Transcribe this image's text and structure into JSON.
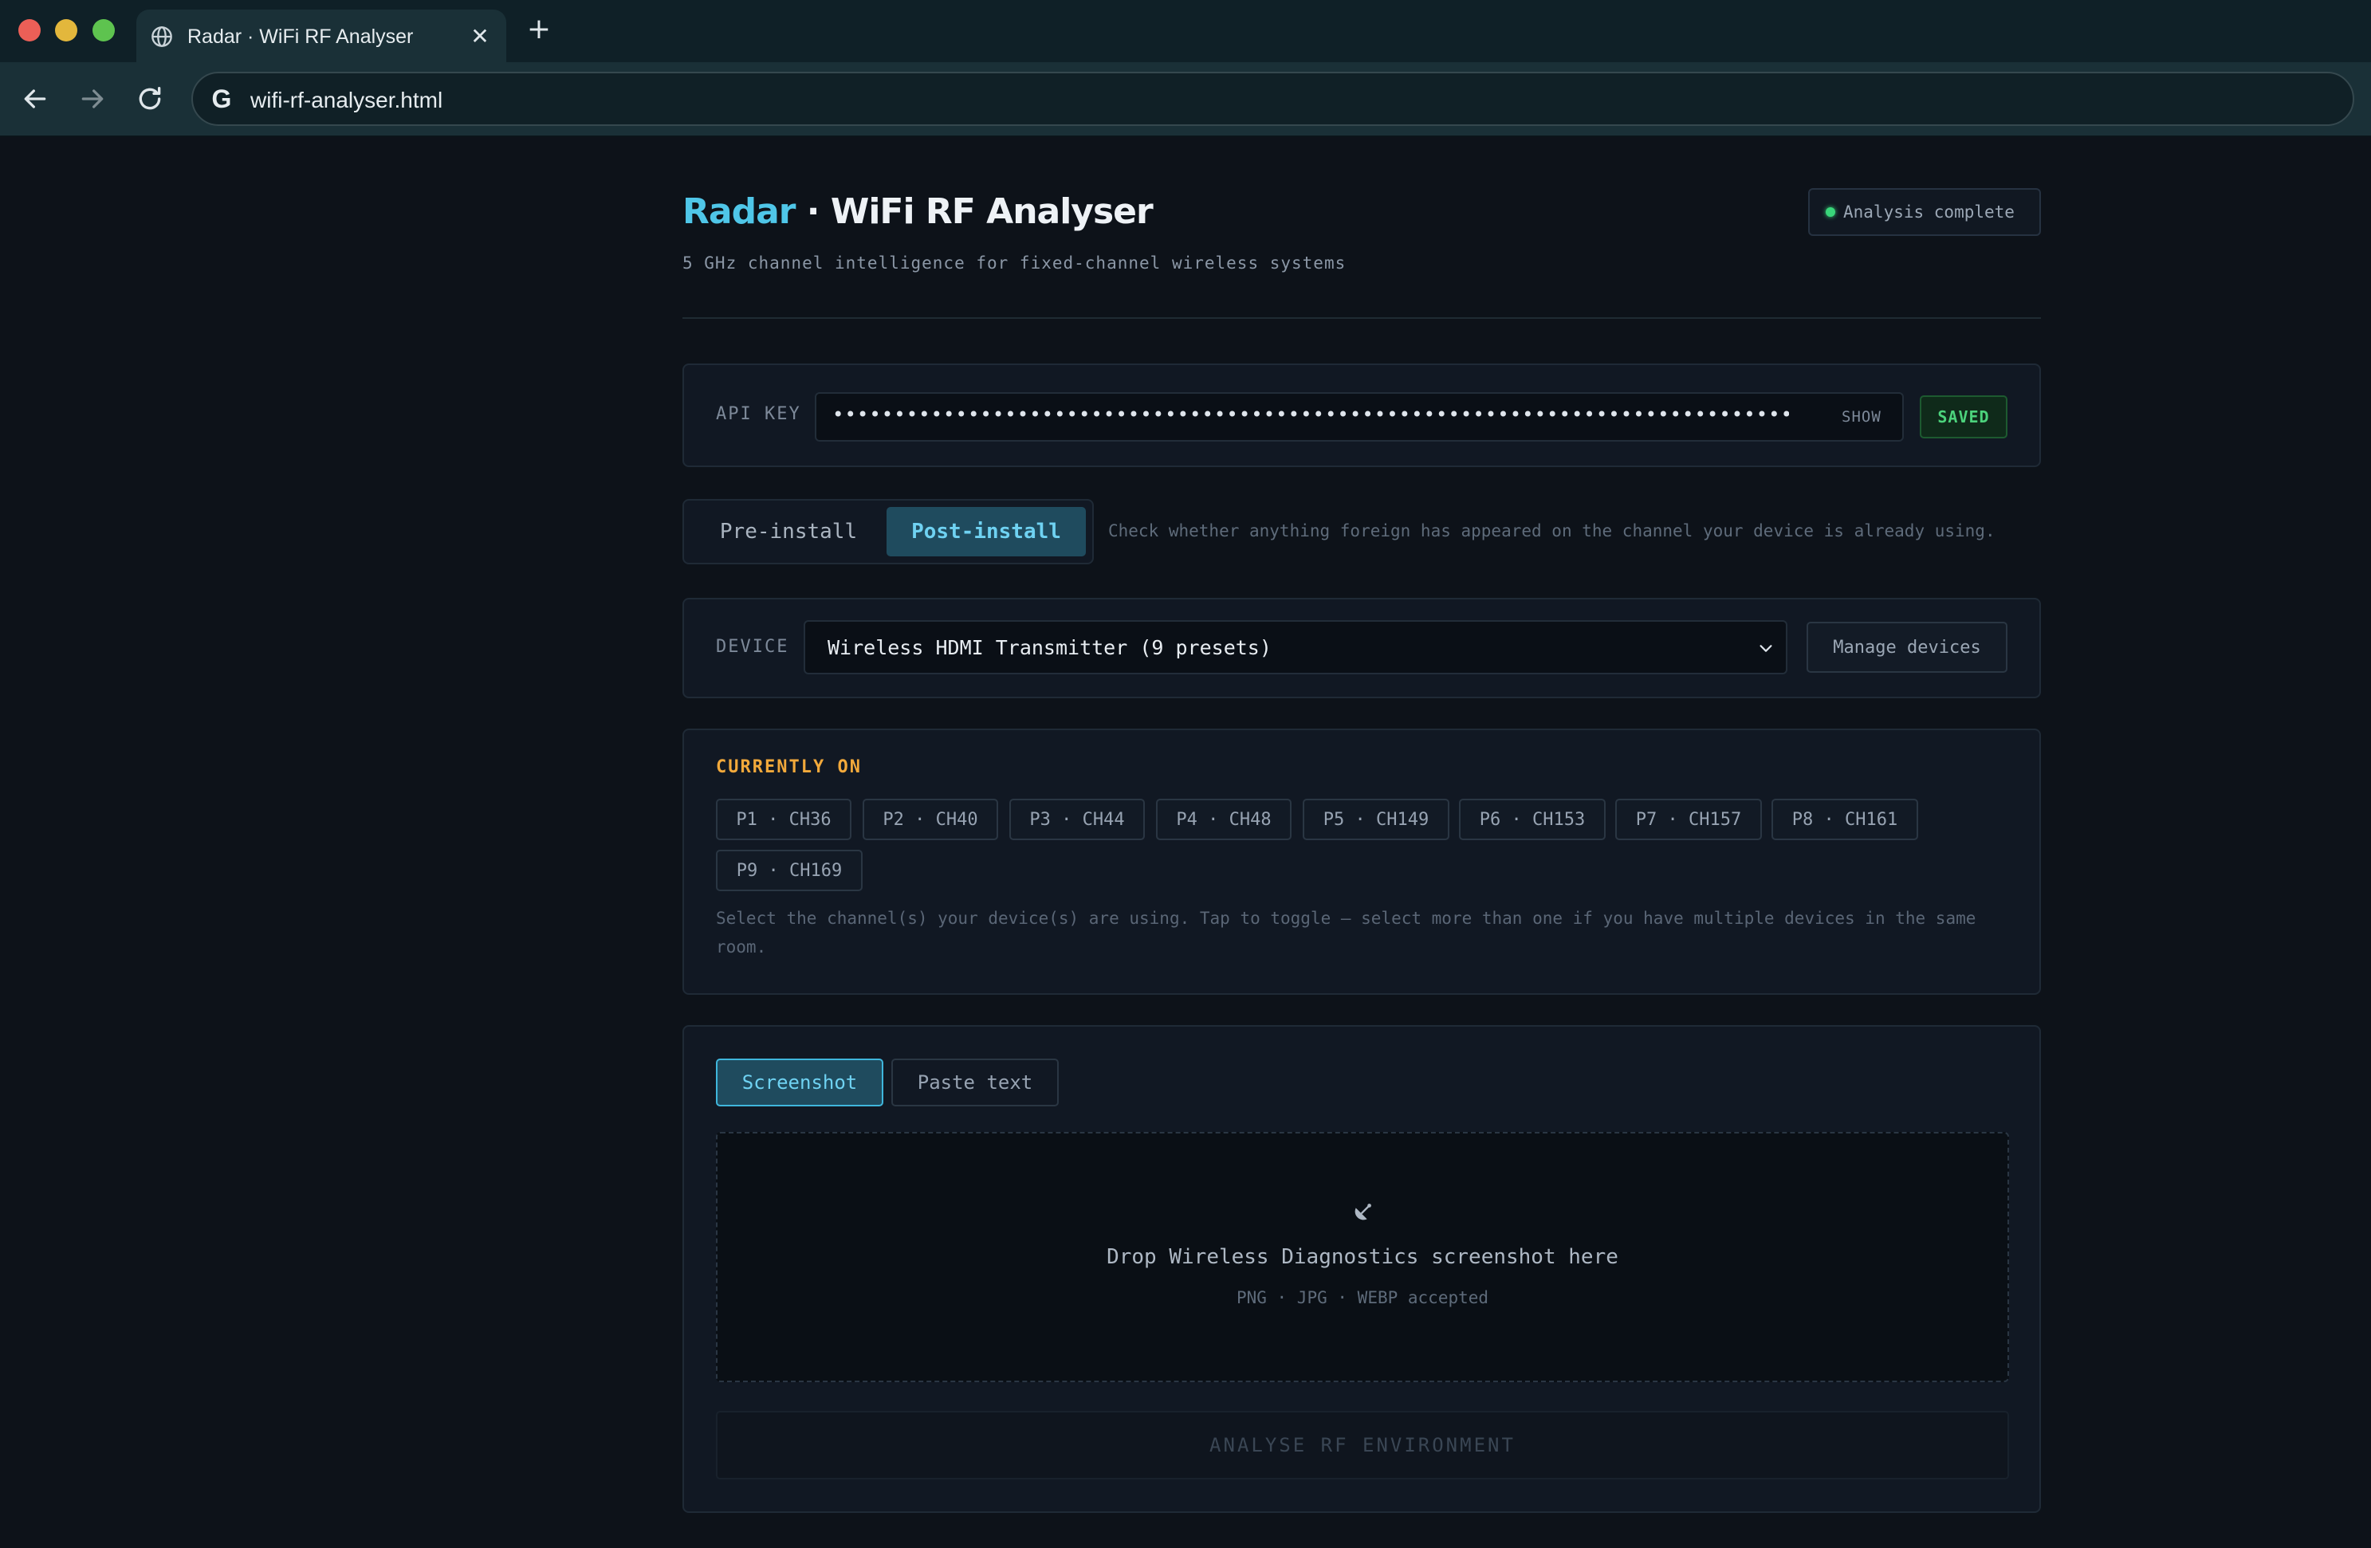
{
  "browser": {
    "tab_title": "Radar · WiFi RF Analyser",
    "url": "wifi-rf-analyser.html"
  },
  "header": {
    "brand_accent": "Radar",
    "brand_rest": " · WiFi RF Analyser",
    "subtitle": "5 GHz channel intelligence for fixed-channel wireless systems",
    "status": "Analysis complete"
  },
  "api": {
    "label": "API KEY",
    "masked_value": "••••••••••••••••••••••••••••••••••••••••••••••••••••••••••••••••••••••••••••••••••••",
    "show_label": "SHOW",
    "saved_label": "SAVED"
  },
  "mode": {
    "pre_label": "Pre-install",
    "post_label": "Post-install",
    "selected": "Post-install",
    "hint": "Check whether anything foreign has appeared on the channel your device is already using."
  },
  "device": {
    "label": "DEVICE",
    "selected": "Wireless HDMI Transmitter (9 presets)",
    "manage_label": "Manage devices"
  },
  "current": {
    "title": "CURRENTLY ON",
    "presets": [
      "P1 · CH36",
      "P2 · CH40",
      "P3 · CH44",
      "P4 · CH48",
      "P5 · CH149",
      "P6 · CH153",
      "P7 · CH157",
      "P8 · CH161",
      "P9 · CH169"
    ],
    "hint": "Select the channel(s) your device(s) are using. Tap to toggle — select more than one if you have multiple devices in the same room."
  },
  "input": {
    "tab_screenshot": "Screenshot",
    "tab_paste": "Paste text",
    "active_tab": "Screenshot",
    "drop_title": "Drop Wireless Diagnostics screenshot here",
    "drop_sub": "PNG · JPG · WEBP accepted",
    "analyse_label": "ANALYSE RF ENVIRONMENT"
  },
  "colors": {
    "accent": "#4fc6e8",
    "status_ok": "#39d67a",
    "warning_title": "#f2a93b",
    "background": "#0d1219"
  }
}
